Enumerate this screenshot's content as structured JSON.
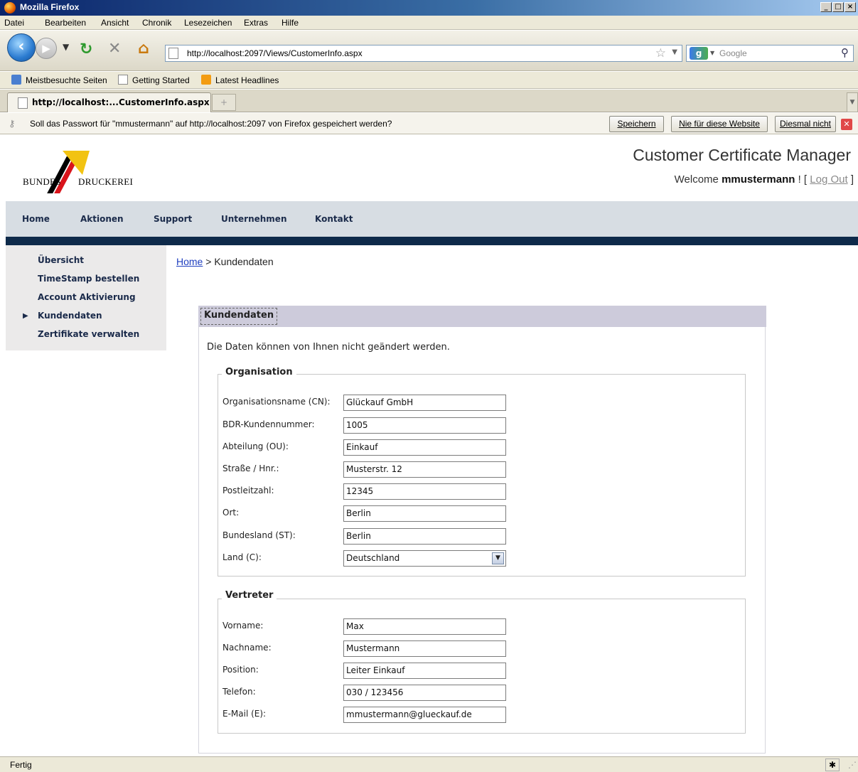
{
  "window": {
    "title": "Mozilla Firefox"
  },
  "menu": [
    "Datei",
    "Bearbeiten",
    "Ansicht",
    "Chronik",
    "Lesezeichen",
    "Extras",
    "Hilfe"
  ],
  "address": {
    "url": "http://localhost:2097/Views/CustomerInfo.aspx"
  },
  "search": {
    "placeholder": "Google"
  },
  "bookmarks": [
    "Meistbesuchte Seiten",
    "Getting Started",
    "Latest Headlines"
  ],
  "tab": {
    "title": "http://localhost:...CustomerInfo.aspx"
  },
  "password_bar": {
    "message": "Soll das Passwort für \"mmustermann\" auf http://localhost:2097 von Firefox gespeichert werden?",
    "save": "Speichern",
    "never": "Nie für diese Website",
    "not_now": "Diesmal nicht"
  },
  "site": {
    "logo_left": "BUNDES",
    "logo_right": "DRUCKEREI",
    "title": "Customer Certificate Manager",
    "welcome": "Welcome",
    "user": "mmustermann",
    "welcome_mid": "! [",
    "logout": "Log Out",
    "welcome_end": "]"
  },
  "topnav": [
    "Home",
    "Aktionen",
    "Support",
    "Unternehmen",
    "Kontakt"
  ],
  "sidenav": [
    "Übersicht",
    "TimeStamp bestellen",
    "Account Aktivierung",
    "Kundendaten",
    "Zertifikate verwalten"
  ],
  "breadcrumb": {
    "home": "Home",
    "separator": ">",
    "current": "Kundendaten"
  },
  "panel": {
    "title": "Kundendaten",
    "note": "Die Daten können von Ihnen nicht geändert werden."
  },
  "organisation": {
    "legend": "Organisation",
    "fields": [
      {
        "label": "Organisationsname (CN):",
        "value": "Glückauf GmbH"
      },
      {
        "label": "BDR-Kundennummer:",
        "value": "1005"
      },
      {
        "label": "Abteilung (OU):",
        "value": "Einkauf"
      },
      {
        "label": "Straße / Hnr.:",
        "value": "Musterstr. 12"
      },
      {
        "label": "Postleitzahl:",
        "value": "12345"
      },
      {
        "label": "Ort:",
        "value": "Berlin"
      },
      {
        "label": "Bundesland (ST):",
        "value": "Berlin"
      },
      {
        "label": "Land (C):",
        "value": "Deutschland"
      }
    ]
  },
  "vertreter": {
    "legend": "Vertreter",
    "fields": [
      {
        "label": "Vorname:",
        "value": "Max"
      },
      {
        "label": "Nachname:",
        "value": "Mustermann"
      },
      {
        "label": "Position:",
        "value": "Leiter Einkauf"
      },
      {
        "label": "Telefon:",
        "value": "030 / 123456"
      },
      {
        "label": "E-Mail (E):",
        "value": "mmustermann@glueckauf.de"
      }
    ]
  },
  "status": {
    "text": "Fertig"
  }
}
